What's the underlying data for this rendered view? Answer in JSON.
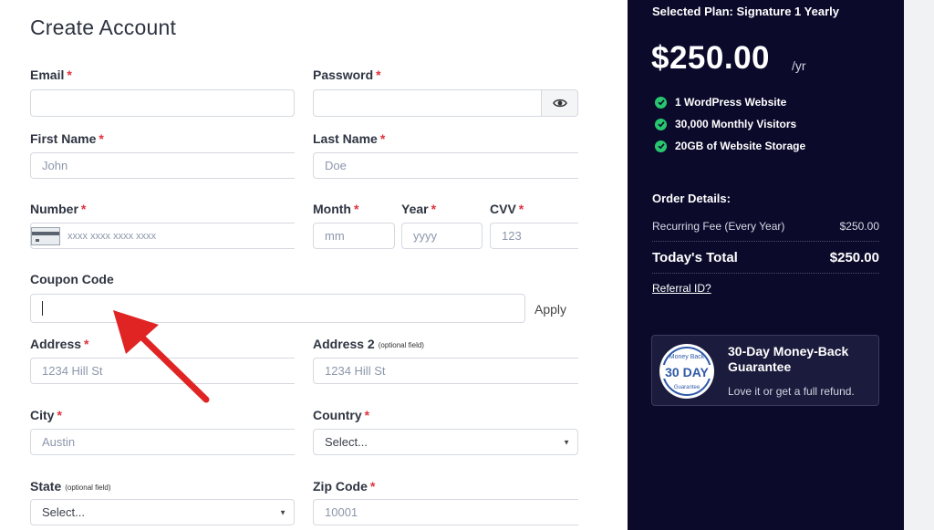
{
  "form": {
    "title": "Create Account",
    "email": {
      "label": "Email",
      "required": "*",
      "value": ""
    },
    "password": {
      "label": "Password",
      "required": "*",
      "value": ""
    },
    "first_name": {
      "label": "First Name",
      "required": "*",
      "placeholder": "John"
    },
    "last_name": {
      "label": "Last Name",
      "required": "*",
      "placeholder": "Doe"
    },
    "number": {
      "label": "Number",
      "required": "*",
      "placeholder": "xxxx xxxx xxxx xxxx"
    },
    "month": {
      "label": "Month",
      "required": "*",
      "placeholder": "mm"
    },
    "year": {
      "label": "Year",
      "required": "*",
      "placeholder": "yyyy"
    },
    "cvv": {
      "label": "CVV",
      "required": "*",
      "placeholder": "123"
    },
    "coupon": {
      "label": "Coupon Code",
      "value": "",
      "apply_label": "Apply"
    },
    "address": {
      "label": "Address",
      "required": "*",
      "placeholder": "1234 Hill St"
    },
    "address2": {
      "label": "Address 2",
      "optional": "(optional field)",
      "placeholder": "1234 Hill St"
    },
    "city": {
      "label": "City",
      "required": "*",
      "placeholder": "Austin"
    },
    "country": {
      "label": "Country",
      "required": "*",
      "selected": "Select..."
    },
    "state": {
      "label": "State",
      "optional": "(optional field)",
      "selected": "Select..."
    },
    "zip": {
      "label": "Zip Code",
      "required": "*",
      "placeholder": "10001"
    }
  },
  "summary": {
    "plan_title": "Selected Plan: Signature 1 Yearly",
    "price": "$250.00",
    "per": "/yr",
    "features": [
      "1 WordPress Website",
      "30,000 Monthly Visitors",
      "20GB of Website Storage"
    ],
    "order_title": "Order Details:",
    "fee_label": "Recurring Fee (Every Year)",
    "fee_value": "$250.00",
    "total_label": "Today's Total",
    "total_value": "$250.00",
    "referral": "Referral ID?",
    "guarantee": {
      "title": "30-Day Money-Back Guarantee",
      "subtitle": "Love it or get a full refund.",
      "badge_top": "Money Back",
      "badge_main": "30 DAY",
      "badge_bottom": "Guarantee"
    }
  },
  "colors": {
    "panel_bg": "#0b0a2b",
    "check_green": "#28c76f",
    "required_red": "#e0323d",
    "arrow_red": "#e02424"
  },
  "icons": {
    "eye": "eye-icon",
    "check": "check-circle-icon",
    "card": "credit-card-icon",
    "chevron": "chevron-down-icon",
    "arrow": "annotation-arrow"
  }
}
